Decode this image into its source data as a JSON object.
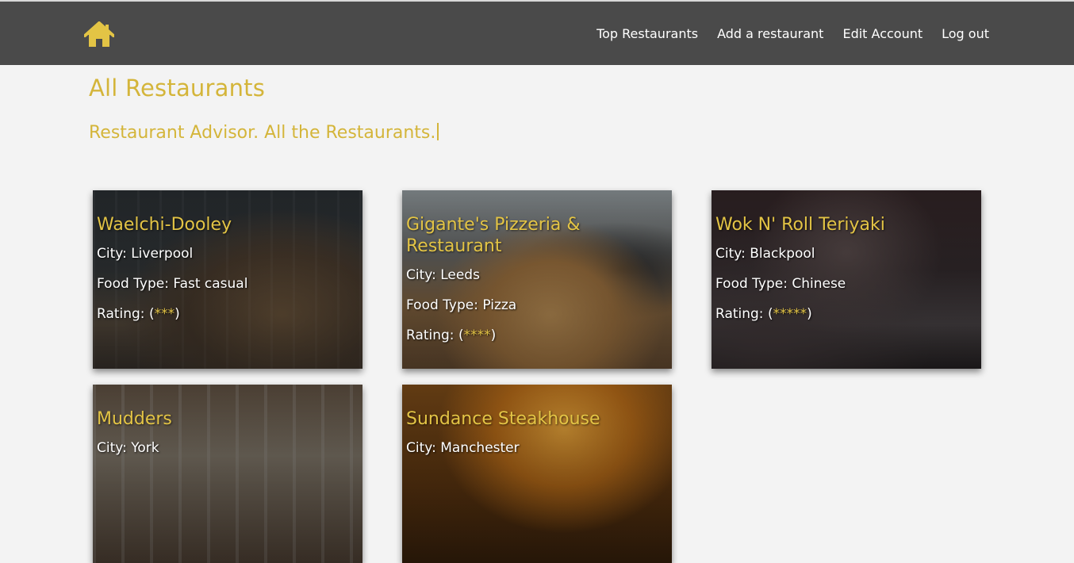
{
  "nav": {
    "home_icon": "home-icon",
    "links": [
      "Top Restaurants",
      "Add a restaurant",
      "Edit Account",
      "Log out"
    ]
  },
  "page": {
    "title": "All Restaurants",
    "tagline": "Restaurant Advisor. All the Restaurants."
  },
  "colors": {
    "accent": "#d4b53a",
    "topbar": "#4a4a4a",
    "background": "#f3f3f3"
  },
  "restaurants": [
    {
      "name": "Waelchi-Dooley",
      "city": "City: Liverpool",
      "food": "Food Type: Fast casual",
      "rating_prefix": "Rating: (",
      "stars": "***",
      "rating_suffix": ")"
    },
    {
      "name": "Gigante's Pizzeria & Restaurant",
      "city": "City: Leeds",
      "food": "Food Type: Pizza",
      "rating_prefix": "Rating: (",
      "stars": "****",
      "rating_suffix": ")"
    },
    {
      "name": "Wok N' Roll Teriyaki",
      "city": "City: Blackpool",
      "food": "Food Type: Chinese",
      "rating_prefix": "Rating: (",
      "stars": "*****",
      "rating_suffix": ")"
    },
    {
      "name": "Mudders",
      "city": "City: York"
    },
    {
      "name": "Sundance Steakhouse",
      "city": "City: Manchester"
    }
  ]
}
